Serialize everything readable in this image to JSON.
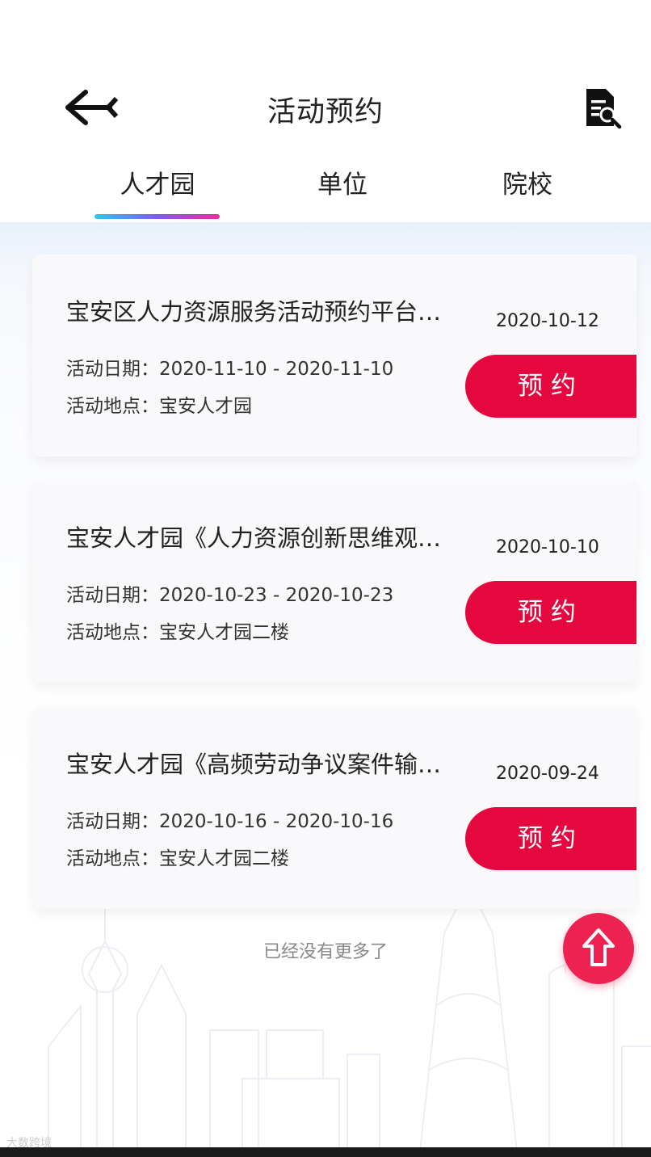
{
  "header": {
    "title": "活动预约",
    "back_icon": "back-arrow-icon",
    "doc_icon": "document-search-icon"
  },
  "tabs": [
    {
      "label": "人才园",
      "active": true
    },
    {
      "label": "单位",
      "active": false
    },
    {
      "label": "院校",
      "active": false
    }
  ],
  "activities": [
    {
      "title": "宝安区人力资源服务活动预约平台…",
      "publish_date": "2020-10-12",
      "date_line": "活动日期：2020-11-10 - 2020-11-10",
      "location_line": "活动地点：宝安人才园",
      "button": "预约"
    },
    {
      "title": "宝安人才园《人力资源创新思维观…",
      "publish_date": "2020-10-10",
      "date_line": "活动日期：2020-10-23 - 2020-10-23",
      "location_line": "活动地点：宝安人才园二楼",
      "button": "预约"
    },
    {
      "title": "宝安人才园《高频劳动争议案件输…",
      "publish_date": "2020-09-24",
      "date_line": "活动日期：2020-10-16 - 2020-10-16",
      "location_line": "活动地点：宝安人才园二楼",
      "button": "预约"
    }
  ],
  "footer": {
    "no_more": "已经没有更多了",
    "top_icon": "arrow-up-icon",
    "watermark": "大数跨境"
  },
  "colors": {
    "accent": "#e4083e",
    "tab_indicator_start": "#2ec8f0",
    "tab_indicator_end": "#ee2b9c"
  }
}
